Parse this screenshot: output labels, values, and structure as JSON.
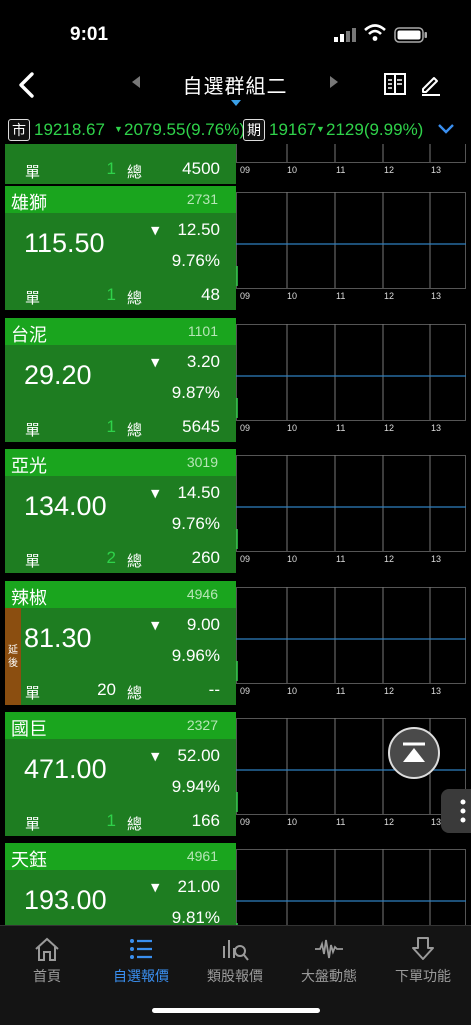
{
  "status_bar": {
    "time": "9:01"
  },
  "nav": {
    "title": "自選群組二"
  },
  "ticker": {
    "market_label": "市",
    "market_value": "19218.67",
    "market_change": "2079.55(9.76%)",
    "futures_label": "期",
    "futures_value": "19167",
    "futures_change": "2129(9.99%)"
  },
  "partial_row": {
    "dan_label": "單",
    "dan_value": "1",
    "zong_label": "總",
    "volume": "4500"
  },
  "chart_ticks": [
    "09",
    "10",
    "11",
    "12",
    "13"
  ],
  "labels": {
    "dan": "單",
    "zong": "總",
    "delay": "延後"
  },
  "stocks": [
    {
      "name": "雄獅",
      "code": "2731",
      "price": "115.50",
      "change": "12.50",
      "pct": "9.76%",
      "dan": "1",
      "volume": "48",
      "delayed": false
    },
    {
      "name": "台泥",
      "code": "1101",
      "price": "29.20",
      "change": "3.20",
      "pct": "9.87%",
      "dan": "1",
      "volume": "5645",
      "delayed": false
    },
    {
      "name": "亞光",
      "code": "3019",
      "price": "134.00",
      "change": "14.50",
      "pct": "9.76%",
      "dan": "2",
      "volume": "260",
      "delayed": false
    },
    {
      "name": "辣椒",
      "code": "4946",
      "price": "81.30",
      "change": "9.00",
      "pct": "9.96%",
      "dan": "20",
      "volume": "--",
      "delayed": true
    },
    {
      "name": "國巨",
      "code": "2327",
      "price": "471.00",
      "change": "52.00",
      "pct": "9.94%",
      "dan": "1",
      "volume": "166",
      "delayed": false
    },
    {
      "name": "天鈺",
      "code": "4961",
      "price": "193.00",
      "change": "21.00",
      "pct": "9.81%",
      "dan": "",
      "volume": "",
      "delayed": false
    }
  ],
  "tabs": [
    {
      "label": "首頁",
      "icon": "home-icon"
    },
    {
      "label": "自選報價",
      "icon": "list-icon"
    },
    {
      "label": "類股報價",
      "icon": "sector-search-icon"
    },
    {
      "label": "大盤動態",
      "icon": "wave-icon"
    },
    {
      "label": "下單功能",
      "icon": "order-icon"
    }
  ],
  "colors": {
    "up_green": "#1aa51e",
    "card_green": "#1e7d21",
    "text_green": "#2fd24a",
    "active_blue": "#3a8ff0",
    "chart_line": "#2f7fbf",
    "delay_brown": "#8b4e10"
  }
}
